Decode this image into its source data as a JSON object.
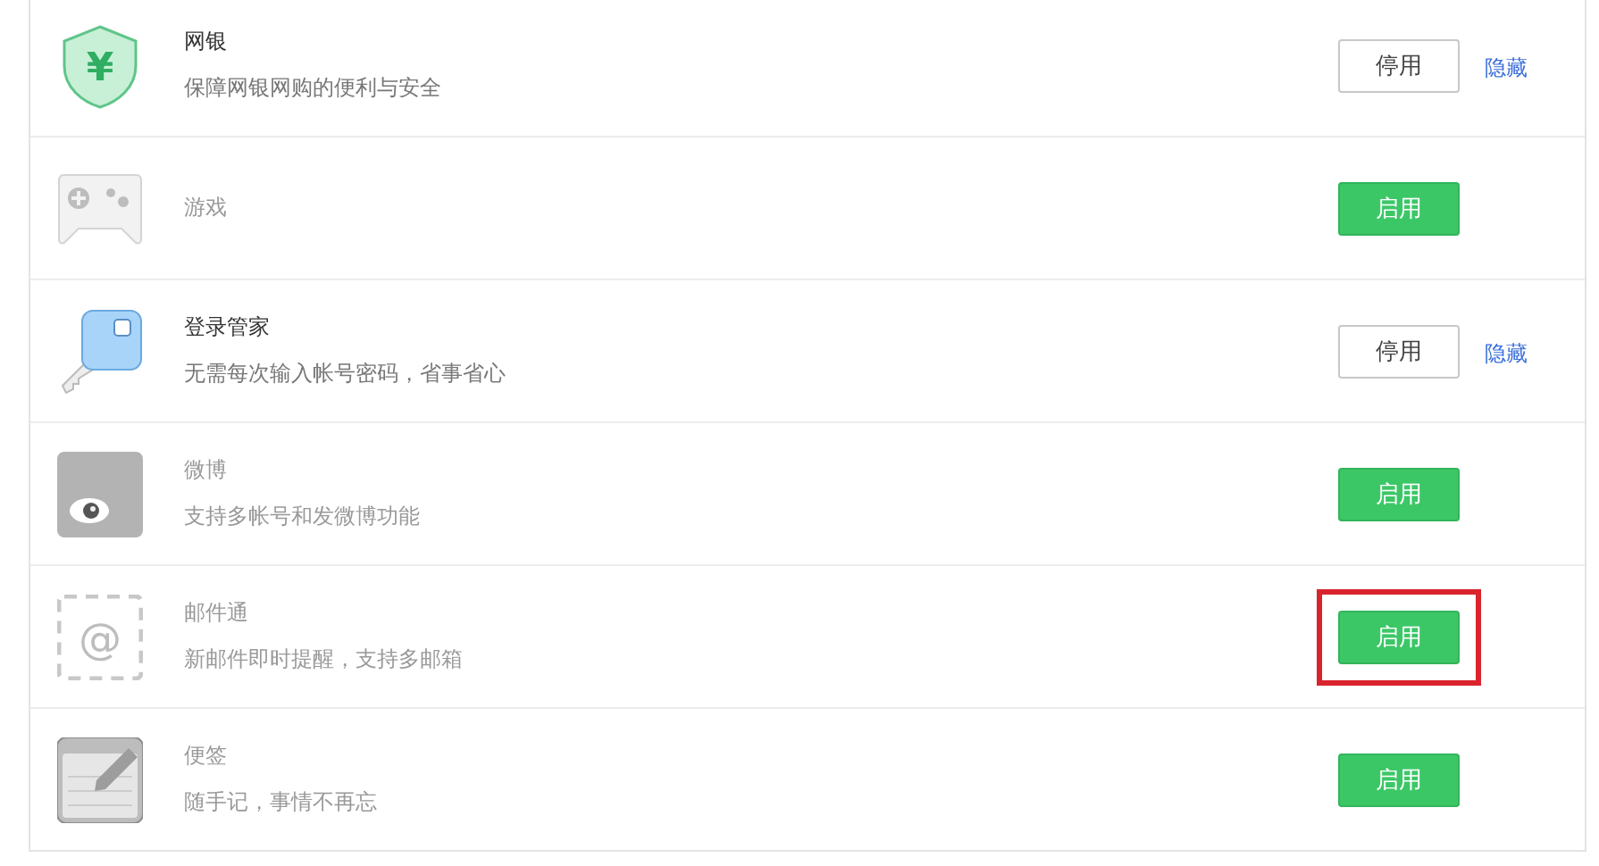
{
  "plugins": [
    {
      "kind": "shield",
      "icon_glyph": "¥",
      "name": "网银",
      "description": "保障网银网购的便利与安全",
      "enabled": true,
      "button": "停用",
      "hide_link": "隐藏",
      "highlighted": false
    },
    {
      "kind": "gamepad",
      "name": "游戏",
      "enabled": false,
      "button": "启用",
      "highlighted": false
    },
    {
      "kind": "key",
      "name": "登录管家",
      "description": "无需每次输入帐号密码，省事省心",
      "enabled": true,
      "button": "停用",
      "hide_link": "隐藏",
      "highlighted": false
    },
    {
      "kind": "eye",
      "name": "微博",
      "description": "支持多帐号和发微博功能",
      "enabled": false,
      "button": "启用",
      "highlighted": false
    },
    {
      "kind": "mail",
      "icon_glyph": "@",
      "name": "邮件通",
      "description": "新邮件即时提醒，支持多邮箱",
      "enabled": false,
      "button": "启用",
      "highlighted": true
    },
    {
      "kind": "notepad",
      "name": "便签",
      "description": "随手记，事情不再忘",
      "enabled": false,
      "button": "启用",
      "highlighted": false
    }
  ]
}
